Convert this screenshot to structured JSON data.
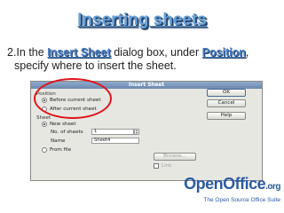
{
  "slide": {
    "title": "Inserting sheets",
    "step_prefix": "2.In the ",
    "step_emphasis_1": "Insert Sheet",
    "step_middle": " dialog box, under ",
    "step_emphasis_2": "Position",
    "step_suffix": ",",
    "step_line2": "specify where to insert the sheet."
  },
  "dialog": {
    "title": "Insert Sheet",
    "position_label": "Position",
    "before_label": "Before current sheet",
    "after_label": "After current sheet",
    "sheet_label": "Sheet",
    "new_sheet_label": "New sheet",
    "num_sheets_label": "No. of sheets",
    "num_sheets_value": "1",
    "name_label": "Name",
    "name_value": "Sheet4",
    "from_file_label": "From file",
    "browse_label": "Browse...",
    "link_label": "Link",
    "ok_label": "OK",
    "cancel_label": "Cancel",
    "help_label": "Help"
  },
  "logo": {
    "word": "OpenOffice",
    "suffix": ".org",
    "tagline": "The Open Source Office Suite"
  },
  "colors": {
    "title": "#6aa2d8",
    "emphasis": "#4a7ec2",
    "highlight": "#e0131b",
    "logo": "#2b5aa0"
  }
}
